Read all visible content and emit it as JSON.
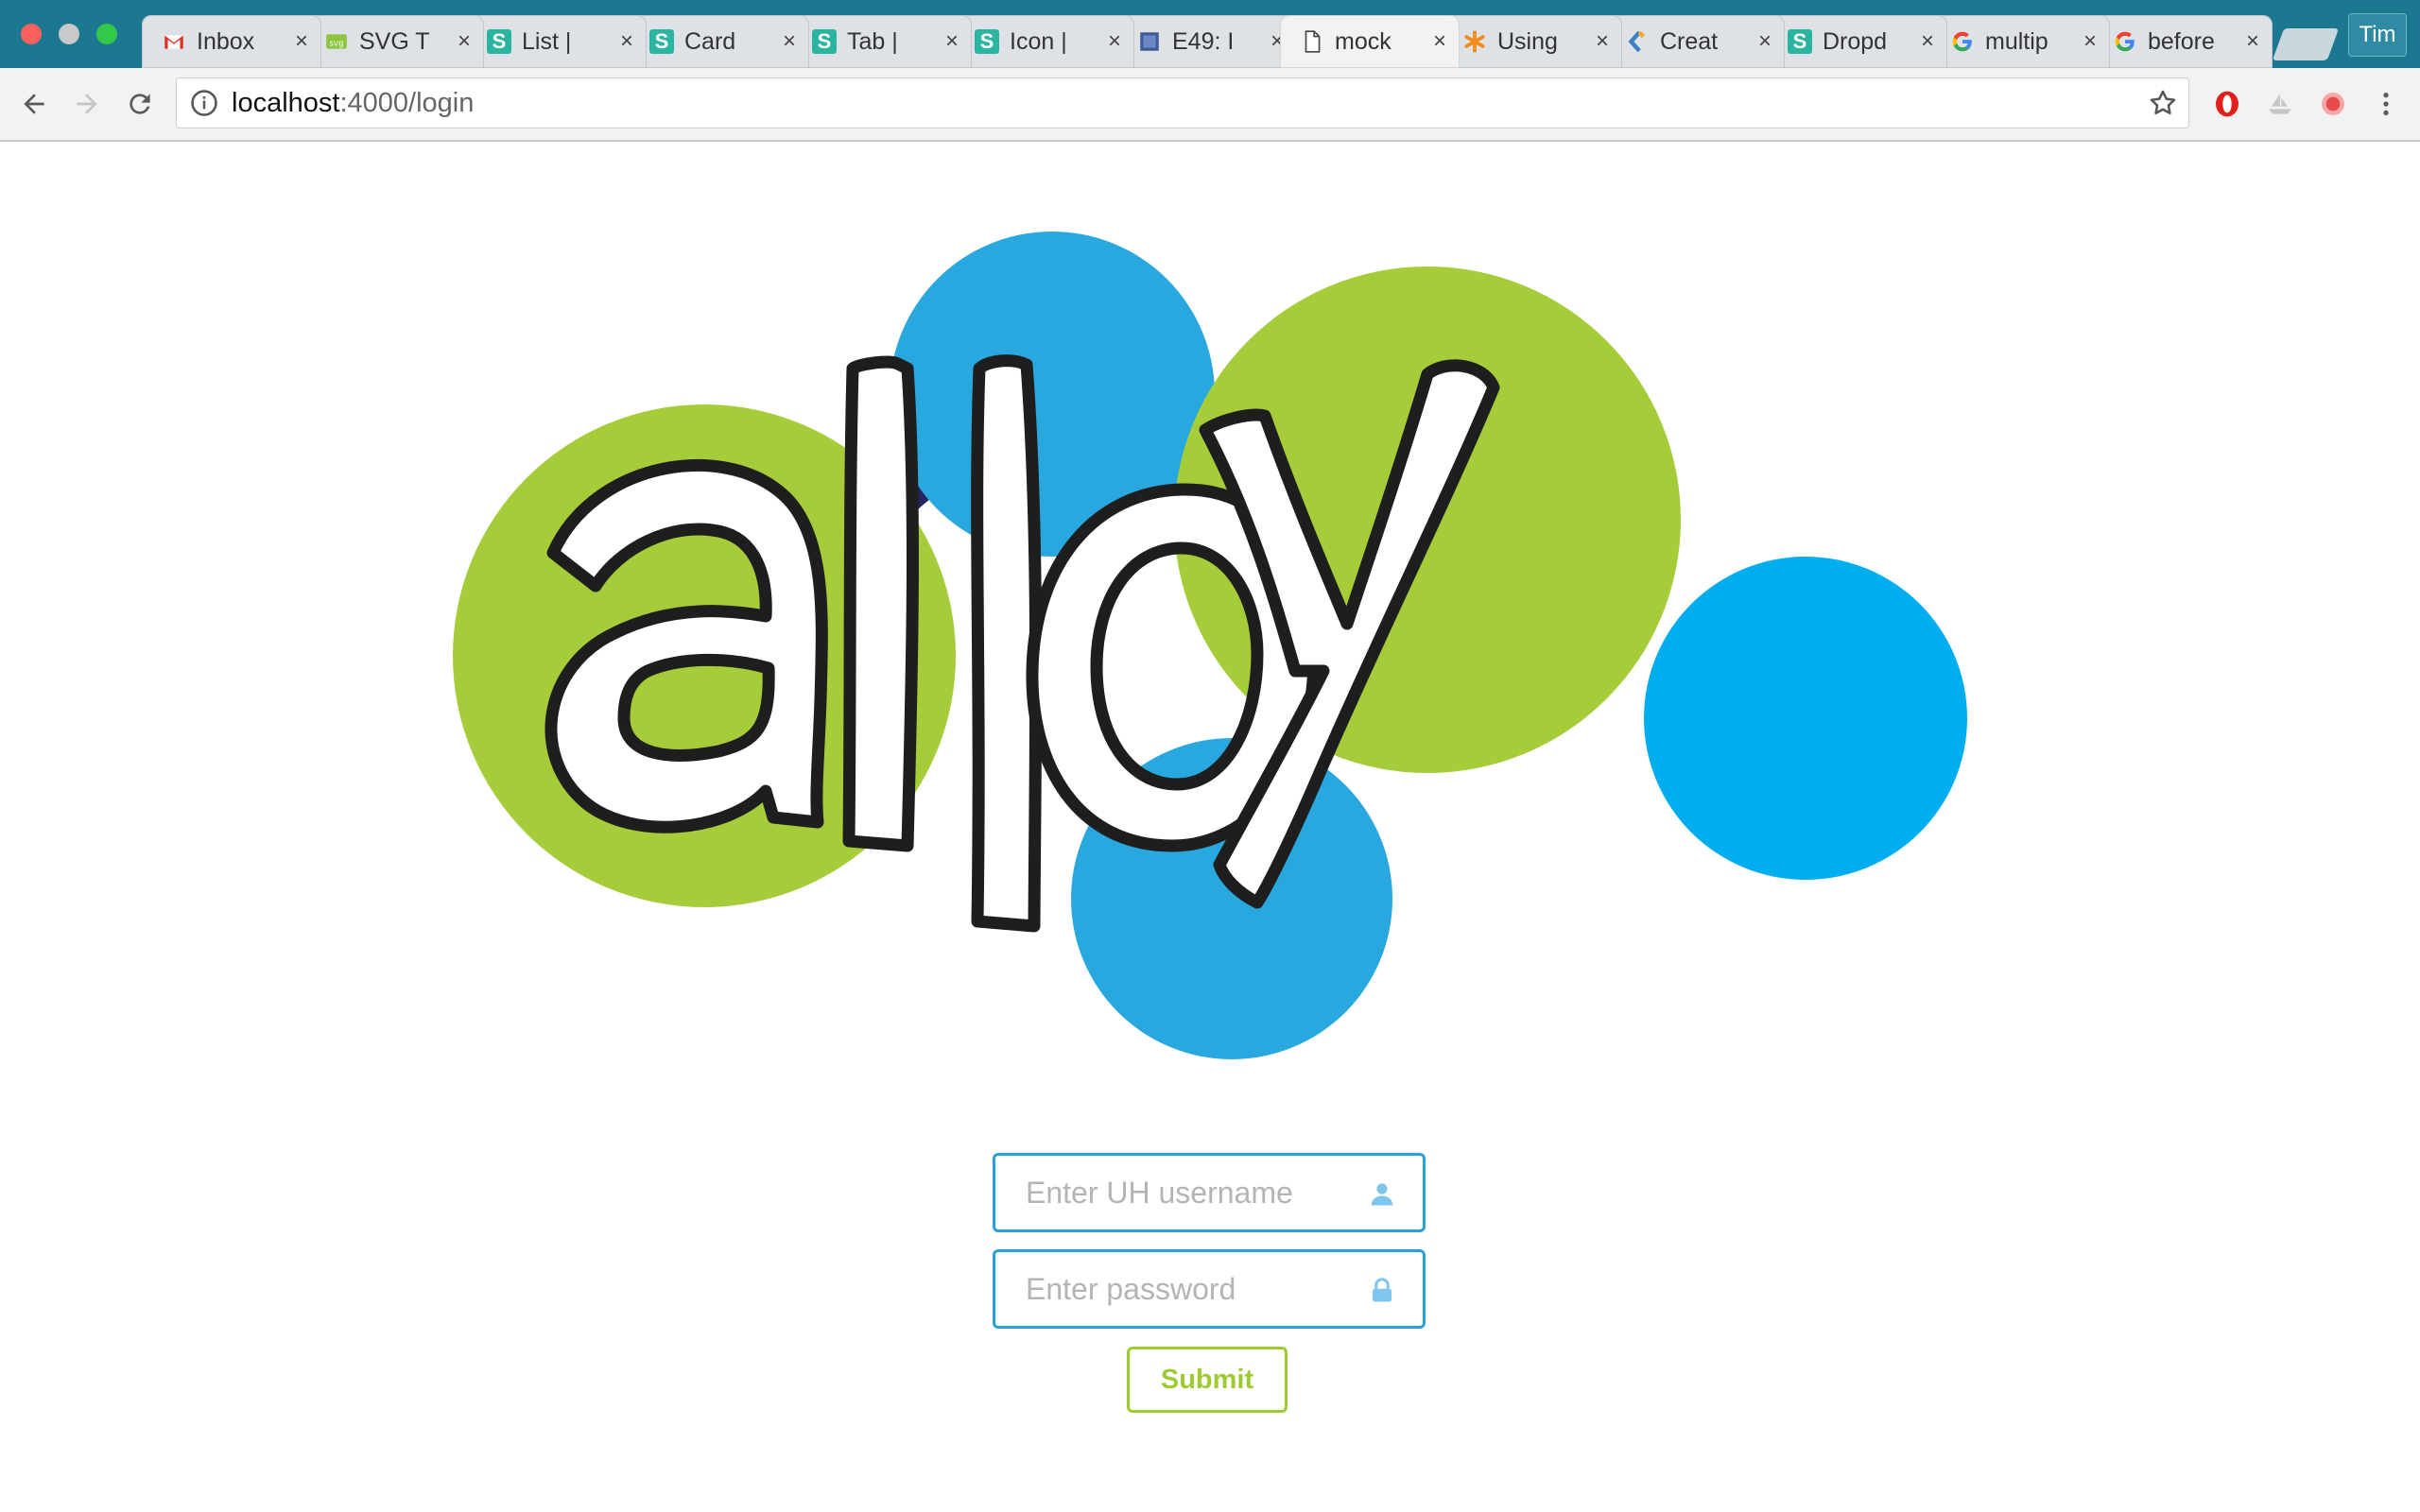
{
  "browser": {
    "tabs": [
      {
        "title": "Inbox",
        "favicon": "gmail-icon"
      },
      {
        "title": "SVG T",
        "favicon": "svg-icon"
      },
      {
        "title": "List |",
        "favicon": "s-icon"
      },
      {
        "title": "Card",
        "favicon": "s-icon"
      },
      {
        "title": "Tab |",
        "favicon": "s-icon"
      },
      {
        "title": "Icon |",
        "favicon": "s-icon"
      },
      {
        "title": "E49: I",
        "favicon": "square-icon"
      },
      {
        "title": "mock",
        "favicon": "document-icon",
        "active": true
      },
      {
        "title": "Using",
        "favicon": "asterisk-icon"
      },
      {
        "title": "Creat",
        "favicon": "chevron-icon"
      },
      {
        "title": "Dropd",
        "favicon": "s-icon"
      },
      {
        "title": "multip",
        "favicon": "google-icon"
      },
      {
        "title": "before",
        "favicon": "google-icon"
      }
    ],
    "profile_name": "Tim",
    "url_host": "localhost",
    "url_rest": ":4000/login"
  },
  "login": {
    "logo_text": "alloy",
    "username_placeholder": "Enter UH username",
    "password_placeholder": "Enter password",
    "submit_label": "Submit"
  },
  "colors": {
    "tabbar": "#1c7891",
    "logo_green": "#a5cd39",
    "logo_blue": "#29a8e0",
    "logo_bright_blue": "#00aeef",
    "logo_navy": "#262262",
    "field_border": "#2c9fd9",
    "submit_green": "#9ecb34"
  }
}
